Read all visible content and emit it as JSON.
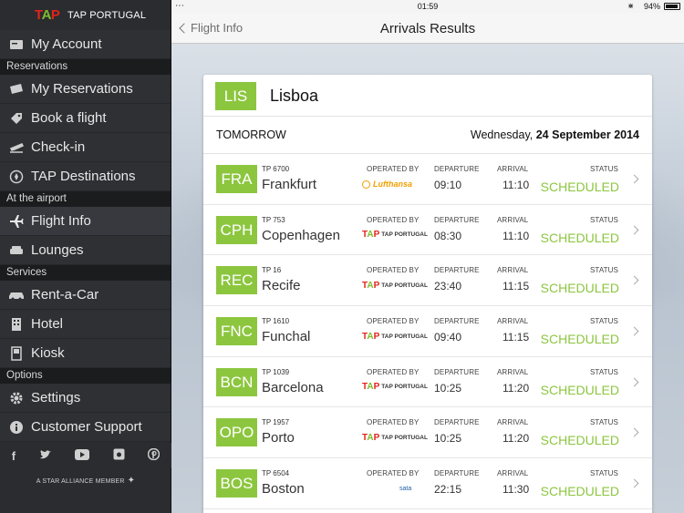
{
  "status_bar": {
    "time": "01:59",
    "battery": "94%"
  },
  "sidebar": {
    "brand": {
      "mark_red": "T",
      "mark_green": "A",
      "mark_red2": "P",
      "word": "TAP PORTUGAL"
    },
    "account": {
      "label": "My Account",
      "icon": "account-card-icon"
    },
    "sections": [
      {
        "title": "Reservations",
        "items": [
          {
            "label": "My Reservations",
            "icon": "ticket-icon"
          },
          {
            "label": "Book a flight",
            "icon": "tag-icon"
          },
          {
            "label": "Check-in",
            "icon": "plane-takeoff-icon"
          },
          {
            "label": "TAP Destinations",
            "icon": "location-pin-icon"
          }
        ]
      },
      {
        "title": "At the airport",
        "items": [
          {
            "label": "Flight Info",
            "icon": "plane-icon",
            "active": true
          },
          {
            "label": "Lounges",
            "icon": "sofa-icon"
          }
        ]
      },
      {
        "title": "Services",
        "items": [
          {
            "label": "Rent-a-Car",
            "icon": "car-icon"
          },
          {
            "label": "Hotel",
            "icon": "hotel-icon"
          },
          {
            "label": "Kiosk",
            "icon": "kiosk-icon"
          }
        ]
      },
      {
        "title": "Options",
        "items": [
          {
            "label": "Settings",
            "icon": "gear-icon"
          },
          {
            "label": "Customer Support",
            "icon": "info-icon"
          }
        ]
      }
    ],
    "social": [
      "facebook-icon",
      "twitter-icon",
      "youtube-icon",
      "instagram-icon",
      "pinterest-icon"
    ],
    "alliance": "A STAR ALLIANCE MEMBER"
  },
  "navbar": {
    "back_label": "Flight Info",
    "title": "Arrivals Results"
  },
  "airport": {
    "code": "LIS",
    "name": "Lisboa"
  },
  "date_row": {
    "day": "TOMORROW",
    "weekday": "Wednesday,",
    "date": "24 September 2014"
  },
  "labels": {
    "operated_by": "OPERATED BY",
    "departure": "DEPARTURE",
    "arrival": "ARRIVAL",
    "status": "STATUS"
  },
  "flights": [
    {
      "code": "FRA",
      "number": "TP 6700",
      "city": "Frankfurt",
      "carrier": "Lufthansa",
      "departure": "09:10",
      "arrival": "11:10",
      "status": "SCHEDULED"
    },
    {
      "code": "CPH",
      "number": "TP 753",
      "city": "Copenhagen",
      "carrier": "TAP PORTUGAL",
      "departure": "08:30",
      "arrival": "11:10",
      "status": "SCHEDULED"
    },
    {
      "code": "REC",
      "number": "TP 16",
      "city": "Recife",
      "carrier": "TAP PORTUGAL",
      "departure": "23:40",
      "arrival": "11:15",
      "status": "SCHEDULED"
    },
    {
      "code": "FNC",
      "number": "TP 1610",
      "city": "Funchal",
      "carrier": "TAP PORTUGAL",
      "departure": "09:40",
      "arrival": "11:15",
      "status": "SCHEDULED"
    },
    {
      "code": "BCN",
      "number": "TP 1039",
      "city": "Barcelona",
      "carrier": "TAP PORTUGAL",
      "departure": "10:25",
      "arrival": "11:20",
      "status": "SCHEDULED"
    },
    {
      "code": "OPO",
      "number": "TP 1957",
      "city": "Porto",
      "carrier": "TAP PORTUGAL",
      "departure": "10:25",
      "arrival": "11:20",
      "status": "SCHEDULED"
    },
    {
      "code": "BOS",
      "number": "TP 6504",
      "city": "Boston",
      "carrier": "sata",
      "departure": "22:15",
      "arrival": "11:30",
      "status": "SCHEDULED"
    }
  ],
  "colors": {
    "accent_green": "#8cc63f",
    "tap_red": "#e2231a",
    "sidebar_bg": "#2b2c30"
  }
}
